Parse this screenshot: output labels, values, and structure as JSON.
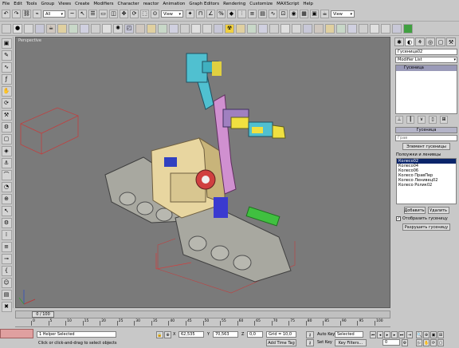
{
  "menu": [
    "File",
    "Edit",
    "Tools",
    "Group",
    "Views",
    "Create",
    "Modifiers",
    "Character",
    "reactor",
    "Animation",
    "Graph Editors",
    "Rendering",
    "Customize",
    "MAXScript",
    "Help"
  ],
  "toolbar": {
    "selection_filter": "All",
    "ref_coord": "View",
    "named_selection": "View",
    "icons_row1": [
      "undo-icon",
      "redo-icon",
      "link-icon",
      "unlink-icon",
      "bind-icon",
      "select-icon",
      "select-by-name-icon",
      "rect-select-icon",
      "window-crossing-icon",
      "move-icon",
      "rotate-icon",
      "scale-icon",
      "pivot-icon",
      "manipulate-icon",
      "snap-icon",
      "angle-snap-icon",
      "percent-snap-icon",
      "spinner-snap-icon",
      "mirror-icon",
      "align-icon",
      "layer-icon",
      "curve-editor-icon",
      "schematic-icon",
      "material-editor-icon",
      "render-setup-icon",
      "render-icon",
      "quick-render-icon"
    ],
    "icons_row2": [
      "box-icon",
      "sphere-icon",
      "cylinder-icon",
      "torus-icon",
      "teapot-icon",
      "cone-icon",
      "geosphere-icon",
      "tube-icon",
      "pyramid-icon",
      "plane-icon",
      "light-icon",
      "camera-icon",
      "helper-icon",
      "spacewarp-icon",
      "system-icon",
      "particle-icon",
      "shape-icon",
      "patch-icon",
      "nurbs-icon",
      "compound-icon",
      "radiation-icon",
      "dynamics-icon",
      "cloth-icon",
      "hair-icon",
      "fur-icon",
      "reactor-icon",
      "rigid-body-icon",
      "soft-body-icon",
      "rope-icon",
      "constraint-icon",
      "wind-icon",
      "motor-icon",
      "fracture-icon",
      "water-icon",
      "toy-car-icon",
      "preview-icon",
      "green-box-icon"
    ]
  },
  "viewport": {
    "label": "Perspective"
  },
  "command_panel": {
    "object_name": "Гусеница02",
    "modifier_list": "Modifier List",
    "stack_item": "Гусеница",
    "rollout_title": "Гусеница",
    "pick_field": "Грав",
    "element_button": "Элемент гусеницы",
    "list_label": "Полоужки и ленивцы",
    "list_items": [
      "Колесо02",
      "Колесо04",
      "Колесо06",
      "Колесо ПравПер",
      "Колесо Ленивец02",
      "Колесо Ролик02"
    ],
    "add_button": "Добавить",
    "delete_button": "Удалить",
    "checkbox_label": "Отобразить гусеницу",
    "checkbox_checked": true,
    "bottom_button": "Разрушить гусеницу"
  },
  "timeline": {
    "frame_label": "0 / 100",
    "ticks": [
      "0",
      "5",
      "10",
      "15",
      "20",
      "25",
      "30",
      "35",
      "40",
      "45",
      "50",
      "55",
      "60",
      "65",
      "70",
      "75",
      "80",
      "85",
      "90",
      "95",
      "100"
    ]
  },
  "status": {
    "selection_count": "1 Helper Selected",
    "prompt": "Click or click-and-drag to select objects",
    "x_label": "X",
    "x_value": "62,535",
    "y_label": "Y",
    "y_value": "70,563",
    "z_label": "Z",
    "z_value": "0,0",
    "grid": "Grid = 10,0",
    "add_time_tag": "Add Time Tag",
    "auto_key": "Auto Key",
    "selected": "Selected",
    "set_key": "Set Key",
    "key_filters": "Key Filters...",
    "frame_value": "0"
  }
}
